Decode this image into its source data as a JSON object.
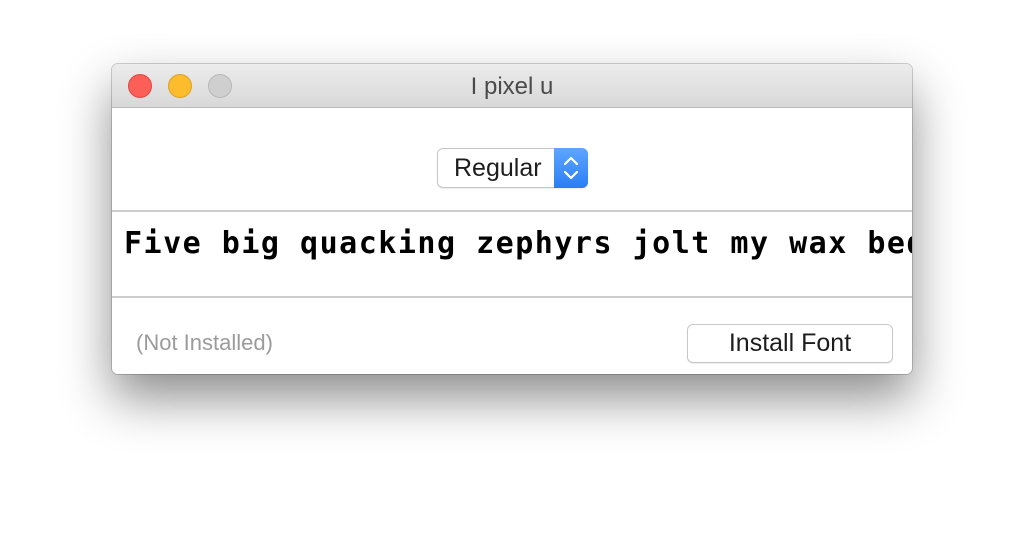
{
  "window": {
    "title": "I pixel u",
    "controls": {
      "close": "close-icon",
      "minimize": "minimize-icon",
      "zoom": "zoom-icon"
    }
  },
  "style_select": {
    "selected": "Regular",
    "icon": "chevron-up-down-icon",
    "accent": "#2a7df5"
  },
  "preview": {
    "sample_text": "Five big quacking zephyrs jolt my wax bed"
  },
  "footer": {
    "status": "(Not Installed)",
    "install_label": "Install Font"
  },
  "colors": {
    "close": "#fc5f57",
    "minimize": "#fdbc2e",
    "zoom": "#cfcfcf",
    "status_text": "#9b9b9b"
  }
}
